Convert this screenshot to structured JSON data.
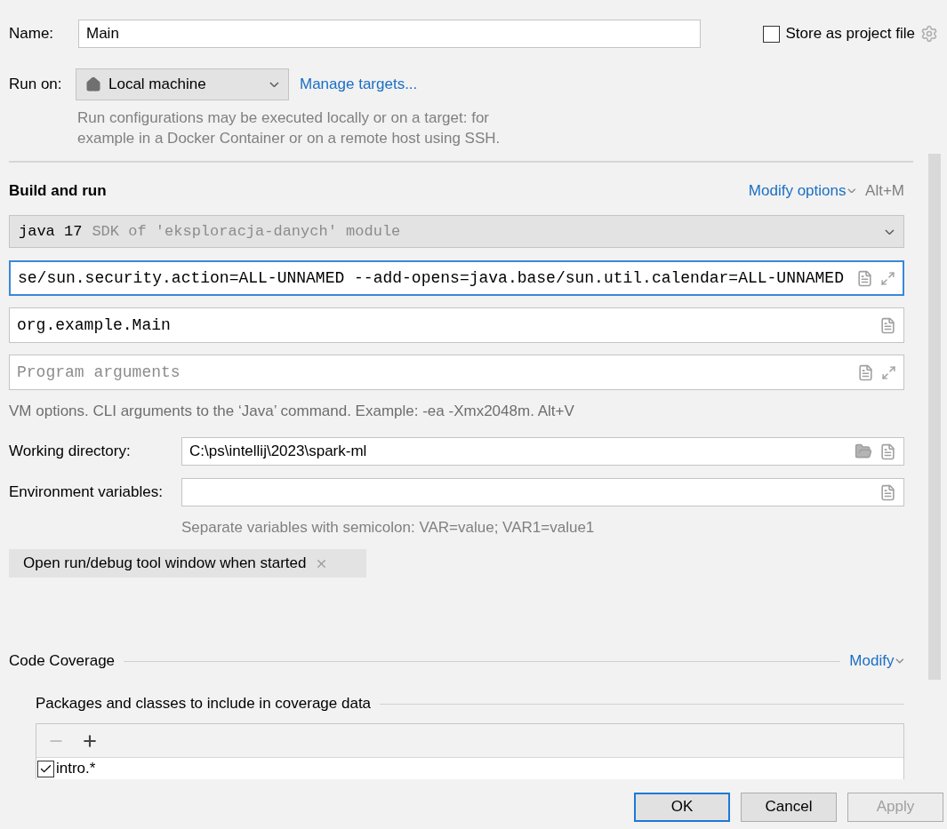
{
  "name_field": {
    "label": "Name:",
    "value": "Main"
  },
  "store_as_project_file": {
    "label": "Store as project file",
    "checked": false
  },
  "run_on": {
    "label": "Run on:",
    "value": "Local machine",
    "link": "Manage targets...",
    "hint": [
      "Run configurations may be executed locally or on a target: for",
      "example in a Docker Container or on a remote host using SSH."
    ]
  },
  "build_and_run": {
    "title": "Build and run",
    "modify_options": "Modify options",
    "shortcut": "Alt+M",
    "sdk": {
      "value": "java 17",
      "detail": "SDK of 'eksploracja-danych' module"
    },
    "fields": [
      {
        "value": "se/sun.security.action=ALL-UNNAMED --add-opens=java.base/sun.util.calendar=ALL-UNNAMED",
        "focused": true,
        "expandable": true
      },
      {
        "value": "org.example.Main",
        "focused": false,
        "expandable": false
      },
      {
        "placeholder": "Program arguments",
        "focused": false,
        "expandable": true
      }
    ],
    "hint": "VM options. CLI arguments to the ‘Java’ command. Example: -ea -Xmx2048m. Alt+V"
  },
  "working_directory": {
    "label": "Working directory:",
    "value": "C:\\ps\\intellij\\2023\\spark-ml"
  },
  "environment_variables": {
    "label": "Environment variables:",
    "hint": "Separate variables with semicolon: VAR=value; VAR1=value1"
  },
  "option_chips": [
    {
      "label": "Open run/debug tool window when started"
    }
  ],
  "code_coverage": {
    "title": "Code Coverage",
    "modify": "Modify",
    "packages_title": "Packages and classes to include in coverage data",
    "entries": [
      {
        "label": "intro.*",
        "checked": true
      }
    ]
  },
  "buttons": [
    {
      "label": "OK",
      "default": true,
      "disabled": false
    },
    {
      "label": "Cancel",
      "default": false,
      "disabled": false
    },
    {
      "label": "Apply",
      "default": false,
      "disabled": true
    }
  ]
}
